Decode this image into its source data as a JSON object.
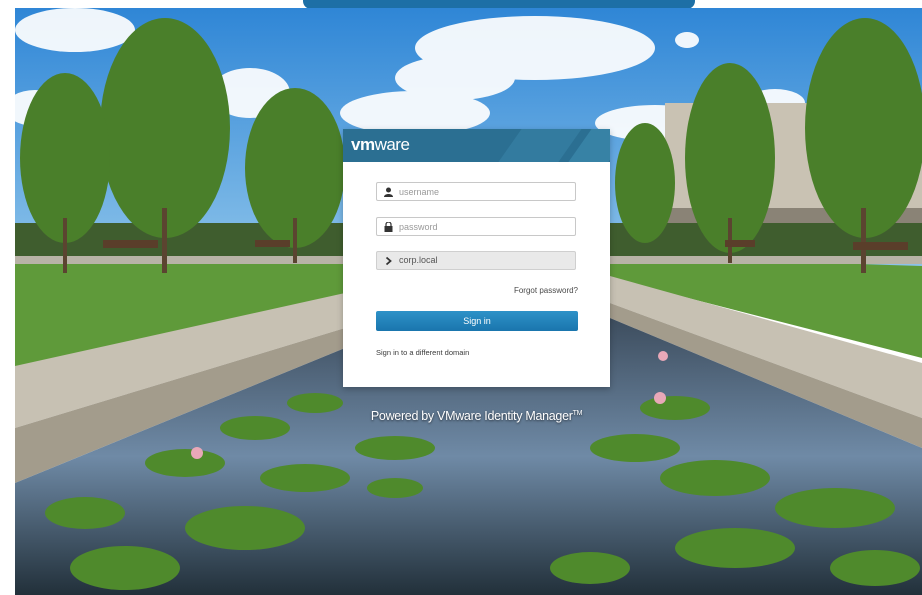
{
  "brand": {
    "logo_vm": "vm",
    "logo_ware": "ware",
    "header_color": "#2b6f92"
  },
  "login": {
    "username_placeholder": "username",
    "password_placeholder": "password",
    "domain_value": "corp.local",
    "forgot_label": "Forgot password?",
    "signin_label": "Sign in",
    "different_domain_label": "Sign in to a different domain"
  },
  "footer": {
    "powered_by": "Powered by VMware Identity Manager",
    "trademark": "TM"
  },
  "colors": {
    "accent": "#1a75ad",
    "tab": "#1d6fa6"
  },
  "icons": {
    "username": "user-icon",
    "password": "lock-icon",
    "domain": "chevron-right-icon"
  }
}
